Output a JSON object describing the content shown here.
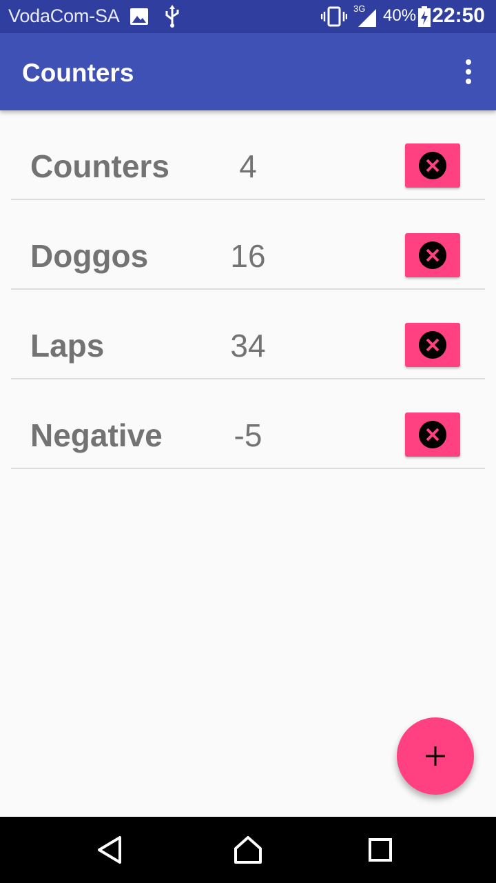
{
  "status_bar": {
    "carrier": "VodaCom-SA",
    "network_type": "3G",
    "battery": "40%",
    "time": "22:50",
    "icons": [
      "image-icon",
      "usb-icon",
      "vibrate-icon",
      "signal-icon",
      "battery-charging-icon"
    ]
  },
  "app_bar": {
    "title": "Counters",
    "overflow_icon": "more-vert-icon"
  },
  "counters": [
    {
      "name": "Counters",
      "count": "4"
    },
    {
      "name": "Doggos",
      "count": "16"
    },
    {
      "name": "Laps",
      "count": "34"
    },
    {
      "name": "Negative",
      "count": "-5"
    }
  ],
  "fab": {
    "icon": "plus-icon"
  },
  "nav_bar": {
    "icons": [
      "back-icon",
      "home-icon",
      "recents-icon"
    ]
  },
  "colors": {
    "status_bar": "#303f9f",
    "app_bar": "#3f51b5",
    "accent": "#ff4081",
    "text_secondary": "#737373",
    "background": "#fafafa"
  }
}
